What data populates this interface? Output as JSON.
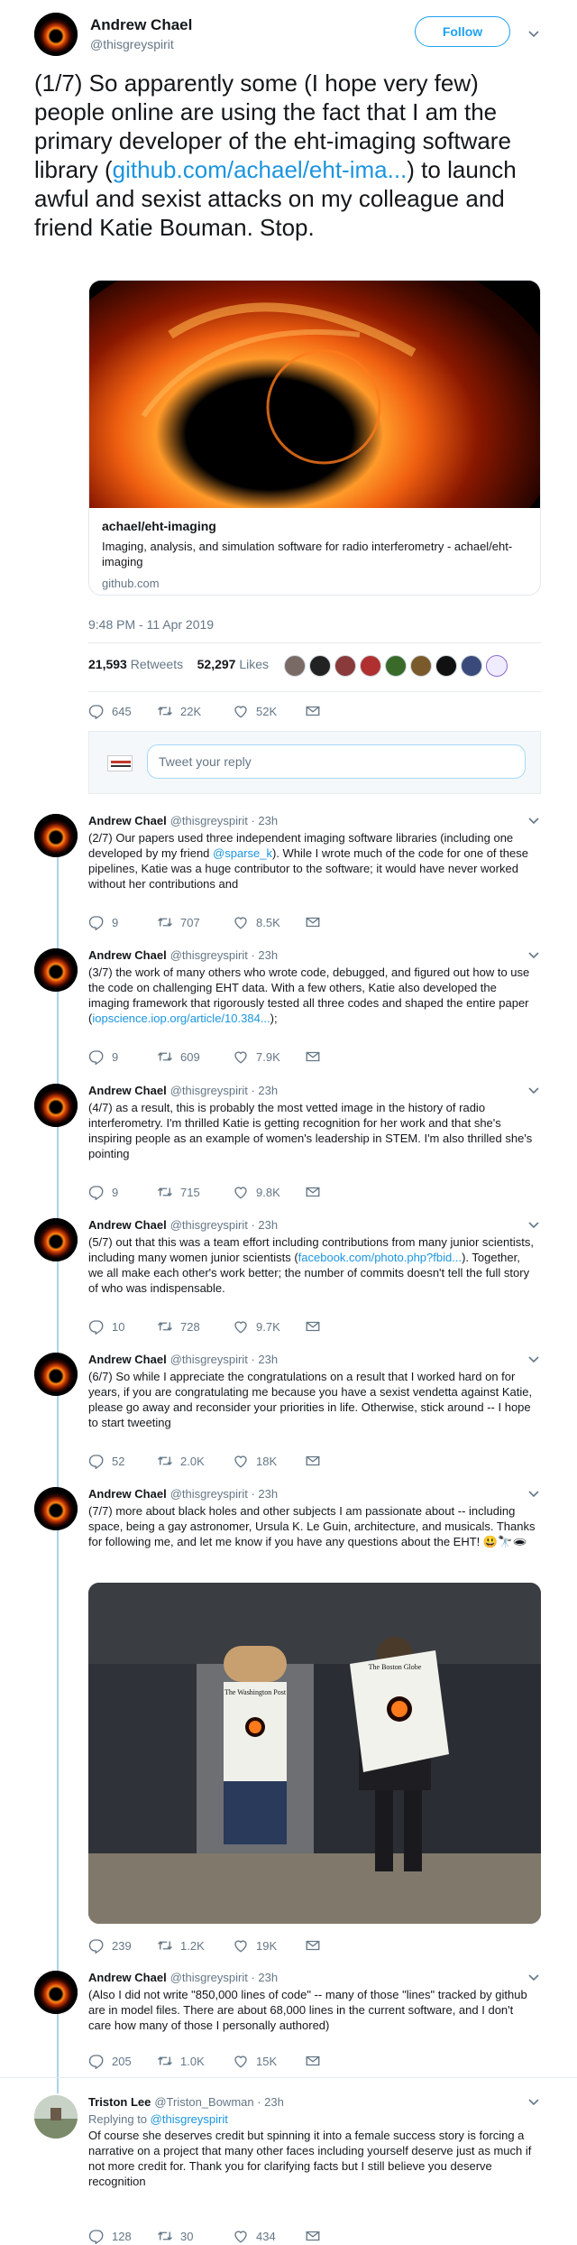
{
  "main": {
    "name": "Andrew Chael",
    "handle": "@thisgreyspirit",
    "follow_label": "Follow",
    "text_before": "(1/7) So apparently some (I hope very few) people online are using the fact that I am the primary developer of the eht-imaging software library (",
    "link": "github.com/achael/eht-ima...",
    "text_after": ") to launch awful and sexist attacks on my colleague and friend Katie Bouman. Stop.",
    "card": {
      "title": "achael/eht-imaging",
      "description": "Imaging, analysis, and simulation software for radio interferometry - achael/eht-imaging",
      "domain": "github.com"
    },
    "timestamp": "9:48 PM - 11 Apr 2019",
    "retweets_count": "21,593",
    "retweets_label": "Retweets",
    "likes_count": "52,297",
    "likes_label": "Likes",
    "actions": {
      "replies": "645",
      "retweets": "22K",
      "likes": "52K"
    },
    "reply_placeholder": "Tweet your reply"
  },
  "colors": {
    "link": "#1b95e0",
    "thread_line": "#a9d3ef",
    "muted": "#657786"
  },
  "replies": [
    {
      "name": "Andrew Chael",
      "handle": "@thisgreyspirit · 23h",
      "text": "(2/7) Our papers used three independent imaging software libraries (including one developed by my friend ",
      "link": "@sparse_k",
      "text2": ").  While I wrote much of the code for one of these pipelines, Katie was a huge contributor to the software; it would have never worked without her contributions and",
      "replies": "9",
      "retweets": "707",
      "likes": "8.5K"
    },
    {
      "name": "Andrew Chael",
      "handle": "@thisgreyspirit · 23h",
      "text": "(3/7) the work of many  others who wrote code, debugged, and figured out how to use the code on challenging EHT data. With a few others, Katie also developed the imaging framework that rigorously tested all three codes and shaped the entire paper (",
      "link": "iopscience.iop.org/article/10.384...",
      "text2": ");",
      "replies": "9",
      "retweets": "609",
      "likes": "7.9K"
    },
    {
      "name": "Andrew Chael",
      "handle": "@thisgreyspirit · 23h",
      "text": "(4/7) as a result, this is probably the most vetted image in the history of radio interferometry. I'm thrilled Katie is getting recognition for her work and that she's inspiring people as an example of women's leadership in STEM. I'm also thrilled she's pointing",
      "link": "",
      "text2": "",
      "replies": "9",
      "retweets": "715",
      "likes": "9.8K"
    },
    {
      "name": "Andrew Chael",
      "handle": "@thisgreyspirit · 23h",
      "text": "(5/7) out that this was a team effort including contributions from many junior scientists, including many women junior scientists (",
      "link": "facebook.com/photo.php?fbid...",
      "text2": "). Together, we all make each other's work better; the number of commits doesn't tell the full story of who was indispensable.",
      "replies": "10",
      "retweets": "728",
      "likes": "9.7K"
    },
    {
      "name": "Andrew Chael",
      "handle": "@thisgreyspirit · 23h",
      "text": "(6/7) So while I appreciate the congratulations on a result that I worked hard on for years, if you are congratulating me because you have a sexist vendetta against Katie, please go away and reconsider your priorities in life. Otherwise, stick around -- I hope to start tweeting",
      "link": "",
      "text2": "",
      "replies": "52",
      "retweets": "2.0K",
      "likes": "18K"
    },
    {
      "name": "Andrew Chael",
      "handle": "@thisgreyspirit · 23h",
      "text": "(7/7) more about black holes and other subjects I am passionate about -- including space, being a gay astronomer, Ursula K. Le Guin, architecture, and musicals. Thanks for following me, and let me know if you have any questions about the EHT! 😃🔭🕳",
      "link": "",
      "text2": "",
      "photo_newspaper_left": "The Washington Post",
      "photo_newspaper_right": "The Boston Globe",
      "replies": "239",
      "retweets": "1.2K",
      "likes": "19K"
    },
    {
      "name": "Andrew Chael",
      "handle": "@thisgreyspirit · 23h",
      "text": "(Also I did not write \"850,000 lines of code\" -- many of those \"lines\" tracked by github are in model files. There are about 68,000 lines in the current software, and I don't care how many of those I personally authored)",
      "link": "",
      "text2": "",
      "replies": "205",
      "retweets": "1.0K",
      "likes": "15K"
    }
  ],
  "last": {
    "name": "Triston Lee",
    "handle": "@Triston_Bowman · 23h",
    "replying_to_label": "Replying to",
    "replying_to": "@thisgreyspirit",
    "text": "Of course she deserves credit but spinning it into a female success story is forcing a narrative on a project that many other faces including yourself deserve just as much if not more credit for. Thank you for clarifying facts but I still believe you deserve recognition",
    "replies": "128",
    "retweets": "30",
    "likes": "434"
  }
}
